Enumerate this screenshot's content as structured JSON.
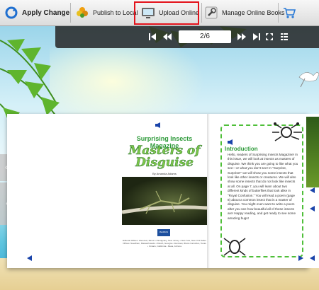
{
  "toolbar": {
    "apply_change": "Apply Change",
    "publish_local": "Publish to Local",
    "upload_online": "Upload Online",
    "manage_online_books": "Manage Online Books"
  },
  "navigation": {
    "page_indicator": "2/6"
  },
  "book": {
    "left_page": {
      "magazine_title": "Surprising Insects Magazine",
      "headline_line1": "Masters of",
      "headline_line2": "Disguise",
      "byline": "By Amanda Adams",
      "publisher_logo": "PEARSON",
      "fine_print": "Editorial Offices: Glenview, Illinois • Parsippany, New Jersey • New York, New York Sales Offices: Needham, Massachusetts • Duluth, Georgia • Glenview, Illinois Carrollton, Texas • Ontario, California • Mesa, Arizona"
    },
    "right_page": {
      "heading": "Introduction",
      "body": "Hello, readers of Surprising Insects Magazine! In this issue, we will look at insects as masters of disguise. We think you are going to like what you see—or what you don't see! In \"Surprise, Surprise!\" we will show you some insects that look like other insects or creatures. We will also show some insects that do not look like insects at all. On page 7, you will learn about two different kinds of butterflies that look alike in \"Royal Confusion.\" You will read a poem (page 8) about a common insect that is a master of disguise. You might even want to write a poem after you see how beautiful all of these insects are! Happy reading, and get ready to see some amazing bugs!"
    }
  },
  "colors": {
    "highlight": "#e3121b",
    "navbar": "#2a2a2a",
    "headline_green": "#7dc64a"
  }
}
